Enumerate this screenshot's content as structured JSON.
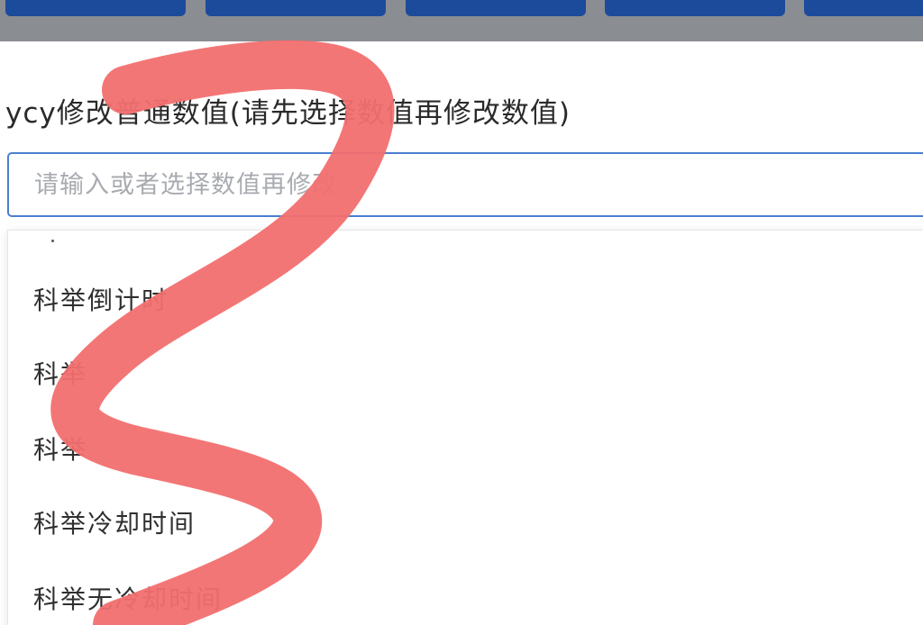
{
  "form": {
    "label": "ycy修改普通数值(请先选择数值再修改数值)",
    "input_placeholder": "请输入或者选择数值再修改"
  },
  "options": [
    {
      "label": "科举倒计时"
    },
    {
      "label": "科举"
    },
    {
      "label": "科举"
    },
    {
      "label": "科举冷却时间"
    },
    {
      "label": "科举无冷却时间"
    }
  ],
  "colors": {
    "toolbar_bg": "#8a8d92",
    "button_blue": "#1c4b9c",
    "input_border": "#4a7fd0",
    "scribble": "#f26f6f"
  }
}
